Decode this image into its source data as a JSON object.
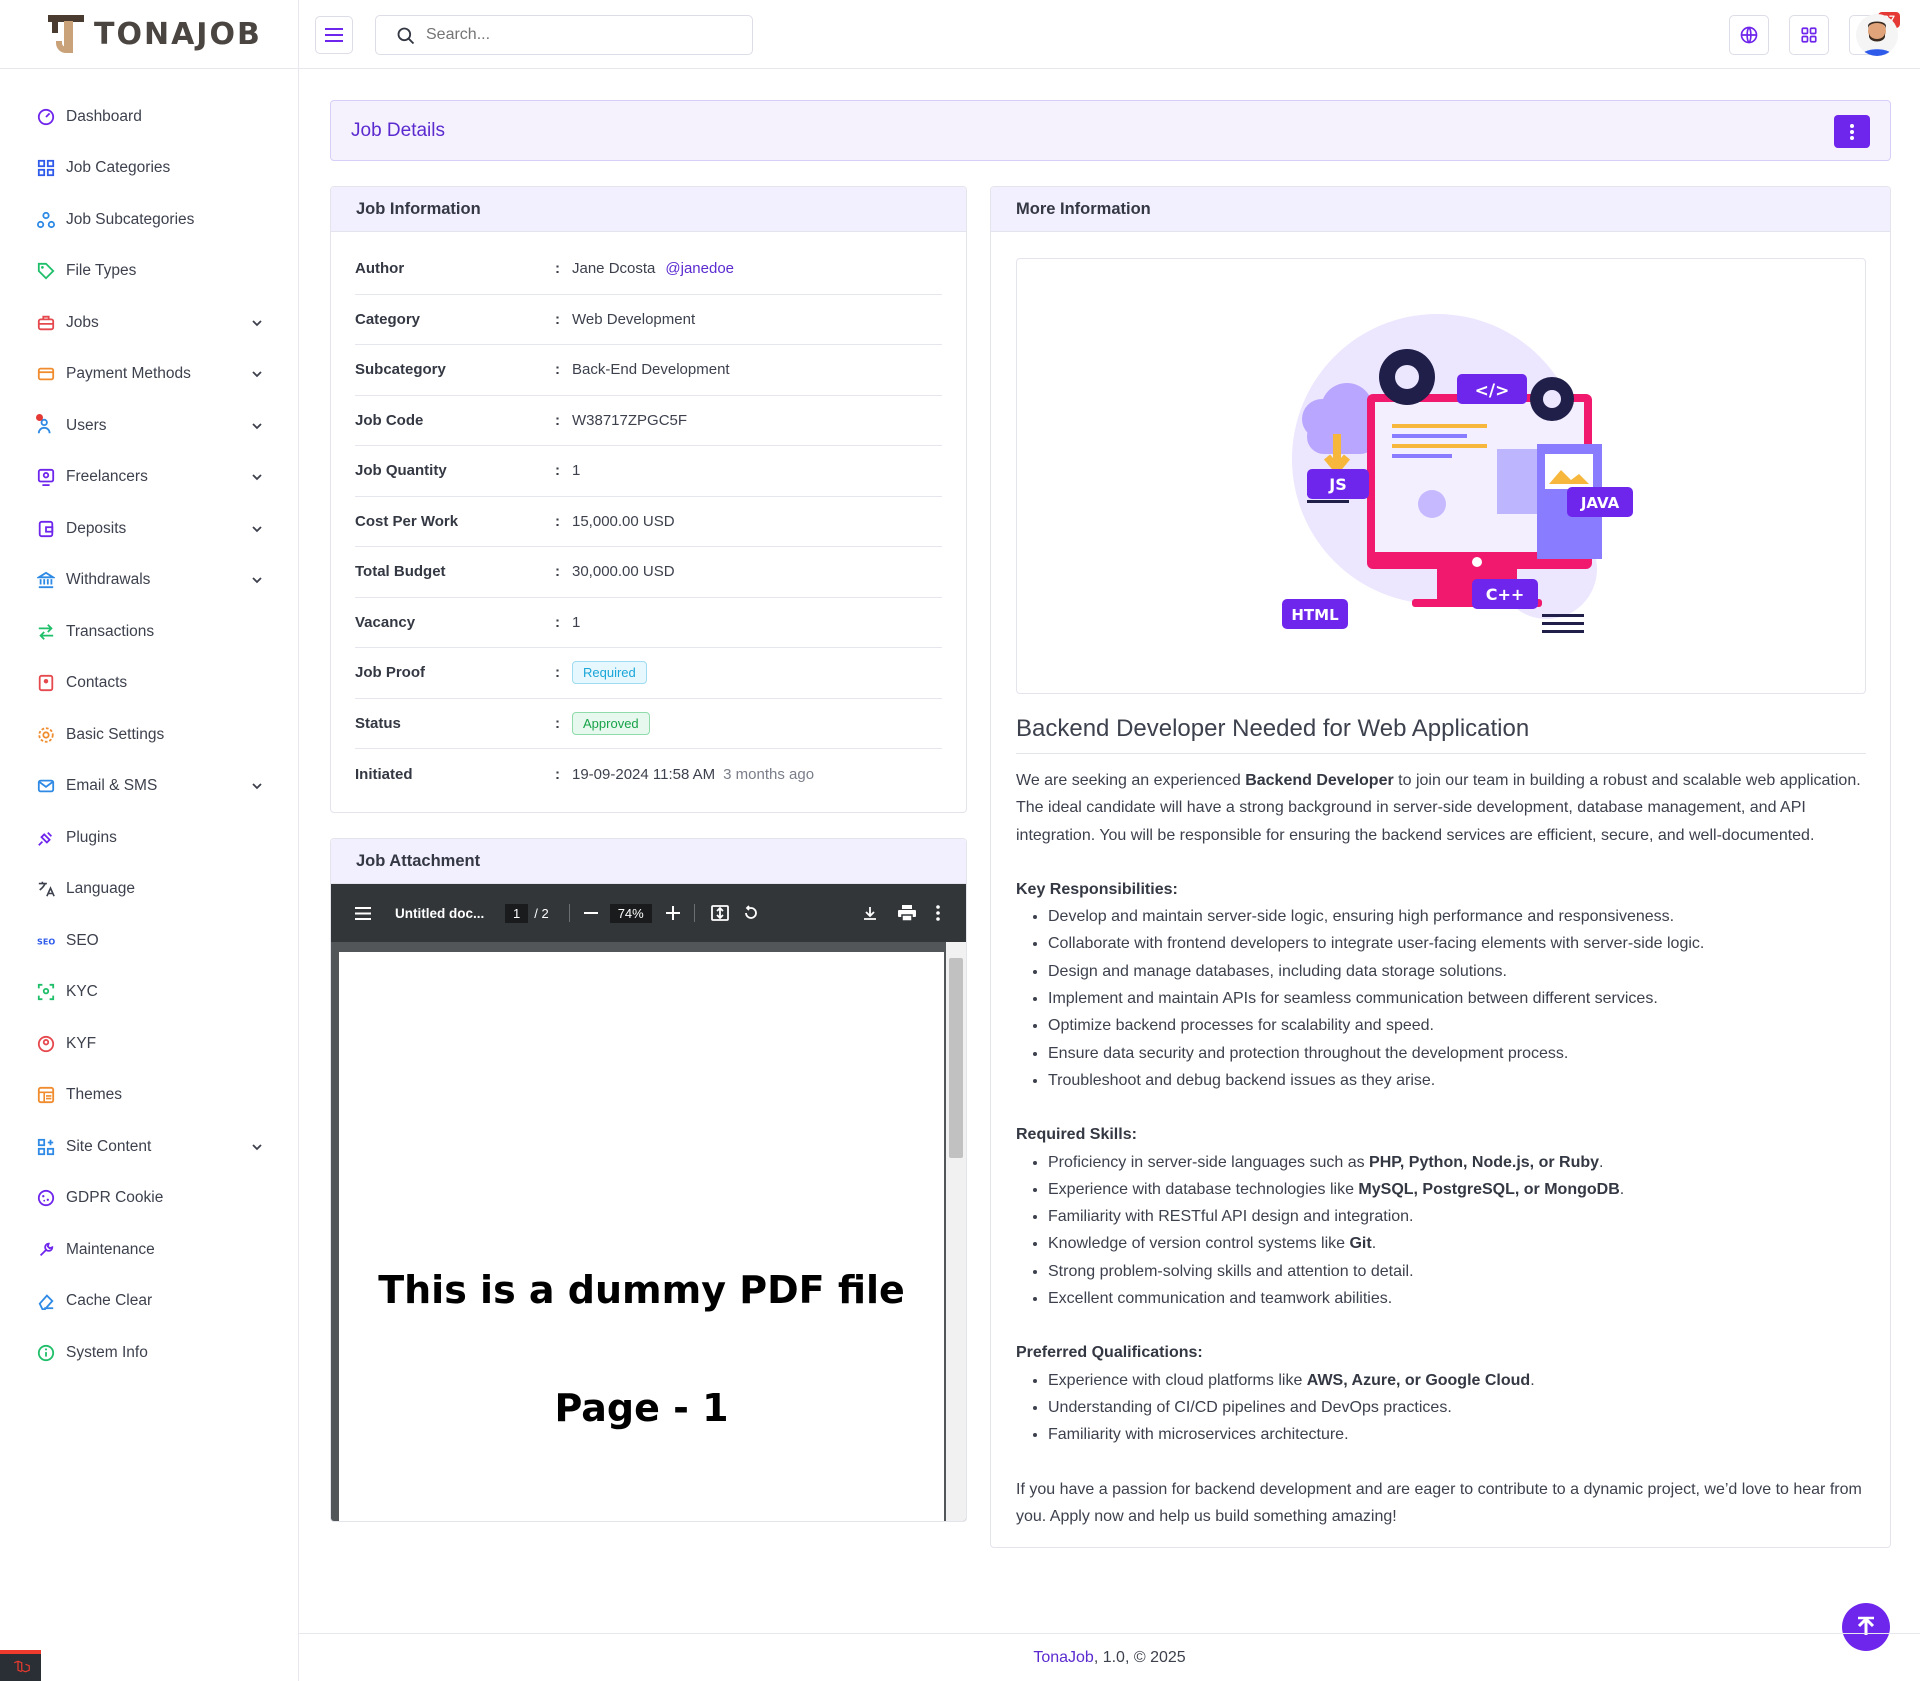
{
  "brand": {
    "logo_text": "TONAJOB"
  },
  "search": {
    "placeholder": "Search..."
  },
  "header": {
    "notification_count": "27"
  },
  "sidebar": {
    "items": [
      {
        "label": "Dashboard",
        "icon": "dashboard-icon",
        "color": "#6f26ec",
        "caret": false
      },
      {
        "label": "Job Categories",
        "icon": "grid-icon",
        "color": "#2f5bea",
        "caret": false
      },
      {
        "label": "Job Subcategories",
        "icon": "sitemap-icon",
        "color": "#2f8ae5",
        "caret": false
      },
      {
        "label": "File Types",
        "icon": "tag-icon",
        "color": "#1fbf6a",
        "caret": false
      },
      {
        "label": "Jobs",
        "icon": "briefcase-icon",
        "color": "#e5484d",
        "caret": true
      },
      {
        "label": "Payment Methods",
        "icon": "credit-card-icon",
        "color": "#f08c2e",
        "caret": true
      },
      {
        "label": "Users",
        "icon": "users-icon",
        "color": "#2f8ae5",
        "caret": true
      },
      {
        "label": "Freelancers",
        "icon": "freelancer-icon",
        "color": "#6f26ec",
        "caret": true
      },
      {
        "label": "Deposits",
        "icon": "wallet-icon",
        "color": "#6f26ec",
        "caret": true
      },
      {
        "label": "Withdrawals",
        "icon": "bank-icon",
        "color": "#2f8ae5",
        "caret": true
      },
      {
        "label": "Transactions",
        "icon": "arrows-icon",
        "color": "#1fbf6a",
        "caret": false
      },
      {
        "label": "Contacts",
        "icon": "contacts-icon",
        "color": "#e5484d",
        "caret": false
      },
      {
        "label": "Basic Settings",
        "icon": "gear-icon",
        "color": "#f08c2e",
        "caret": false
      },
      {
        "label": "Email & SMS",
        "icon": "mail-icon",
        "color": "#2f8ae5",
        "caret": true
      },
      {
        "label": "Plugins",
        "icon": "plug-icon",
        "color": "#6f26ec",
        "caret": false
      },
      {
        "label": "Language",
        "icon": "translate-icon",
        "color": "#3d414d",
        "caret": false
      },
      {
        "label": "SEO",
        "icon": "seo-icon",
        "color": "#2f5bea",
        "caret": false
      },
      {
        "label": "KYC",
        "icon": "scan-face-icon",
        "color": "#1fbf6a",
        "caret": false
      },
      {
        "label": "KYF",
        "icon": "badge-user-icon",
        "color": "#e5484d",
        "caret": false
      },
      {
        "label": "Themes",
        "icon": "themes-icon",
        "color": "#f08c2e",
        "caret": false
      },
      {
        "label": "Site Content",
        "icon": "blocks-icon",
        "color": "#2f8ae5",
        "caret": true
      },
      {
        "label": "GDPR Cookie",
        "icon": "cookie-icon",
        "color": "#6f26ec",
        "caret": false
      },
      {
        "label": "Maintenance",
        "icon": "wrench-icon",
        "color": "#6f26ec",
        "caret": false
      },
      {
        "label": "Cache Clear",
        "icon": "eraser-icon",
        "color": "#2f8ae5",
        "caret": false
      },
      {
        "label": "System Info",
        "icon": "info-icon",
        "color": "#1fbf6a",
        "caret": false
      }
    ]
  },
  "page": {
    "title": "Job Details"
  },
  "job_info": {
    "title": "Job Information",
    "author_name": "Jane Dcosta",
    "author_username": "@janedoe",
    "rows": [
      {
        "label": "Author"
      },
      {
        "label": "Category",
        "value": "Web Development"
      },
      {
        "label": "Subcategory",
        "value": "Back-End Development"
      },
      {
        "label": "Job Code",
        "value": "W38717ZPGC5F"
      },
      {
        "label": "Job Quantity",
        "value": "1"
      },
      {
        "label": "Cost Per Work",
        "value": "15,000.00 USD"
      },
      {
        "label": "Total Budget",
        "value": "30,000.00 USD"
      },
      {
        "label": "Vacancy",
        "value": "1"
      },
      {
        "label": "Job Proof",
        "value": "Required"
      },
      {
        "label": "Status",
        "value": "Approved"
      },
      {
        "label": "Initiated",
        "value": "19-09-2024 11:58 AM"
      }
    ],
    "initiated_ago": "3 months ago",
    "colon": ":"
  },
  "attachment": {
    "title": "Job Attachment",
    "file_name": "Untitled doc...",
    "page_current": "1",
    "page_total": "/ 2",
    "zoom": "74%",
    "pdf_line1": "This is a dummy PDF file",
    "pdf_line2": "Page - 1"
  },
  "more_info": {
    "title": "More Information",
    "illustration_labels": {
      "js": "JS",
      "java": "JAVA",
      "html": "HTML",
      "cpp": "C++",
      "code": "</>"
    },
    "job_title": "Backend Developer Needed for Web Application",
    "intro_before": "We are seeking an experienced ",
    "intro_bold": "Backend Developer",
    "intro_after": " to join our team in building a robust and scalable web application. The ideal candidate will have a strong background in server-side development, database management, and API integration. You will be responsible for ensuring the backend services are efficient, secure, and well-documented.",
    "resp_heading": "Key Responsibilities:",
    "responsibilities": [
      "Develop and maintain server-side logic, ensuring high performance and responsiveness.",
      "Collaborate with frontend developers to integrate user-facing elements with server-side logic.",
      "Design and manage databases, including data storage solutions.",
      "Implement and maintain APIs for seamless communication between different services.",
      "Optimize backend processes for scalability and speed.",
      "Ensure data security and protection throughout the development process.",
      "Troubleshoot and debug backend issues as they arise."
    ],
    "skills_heading": "Required Skills:",
    "skills": [
      {
        "text": "Proficiency in server-side languages such as ",
        "bold": "PHP, Python, Node.js, or Ruby",
        "end": "."
      },
      {
        "text": "Experience with database technologies like ",
        "bold": "MySQL, PostgreSQL, or MongoDB",
        "end": "."
      },
      {
        "text": "Familiarity with RESTful API design and integration.",
        "bold": "",
        "end": ""
      },
      {
        "text": "Knowledge of version control systems like ",
        "bold": "Git",
        "end": "."
      },
      {
        "text": "Strong problem-solving skills and attention to detail.",
        "bold": "",
        "end": ""
      },
      {
        "text": "Excellent communication and teamwork abilities.",
        "bold": "",
        "end": ""
      }
    ],
    "pref_heading": "Preferred Qualifications:",
    "preferred": [
      {
        "text": "Experience with cloud platforms like ",
        "bold": "AWS, Azure, or Google Cloud",
        "end": "."
      },
      {
        "text": "Understanding of CI/CD pipelines and DevOps practices.",
        "bold": "",
        "end": ""
      },
      {
        "text": "Familiarity with microservices architecture.",
        "bold": "",
        "end": ""
      }
    ],
    "closing": "If you have a passion for backend development and are eager to contribute to a dynamic project, we’d love to hear from you. Apply now and help us build something amazing!"
  },
  "footer": {
    "brand": "TonaJob",
    "rest": ", 1.0, © 2025"
  },
  "colors": {
    "accent": "#6f26ec",
    "accent_text": "#5b2bd0",
    "card_head_bg": "#f2efff"
  }
}
